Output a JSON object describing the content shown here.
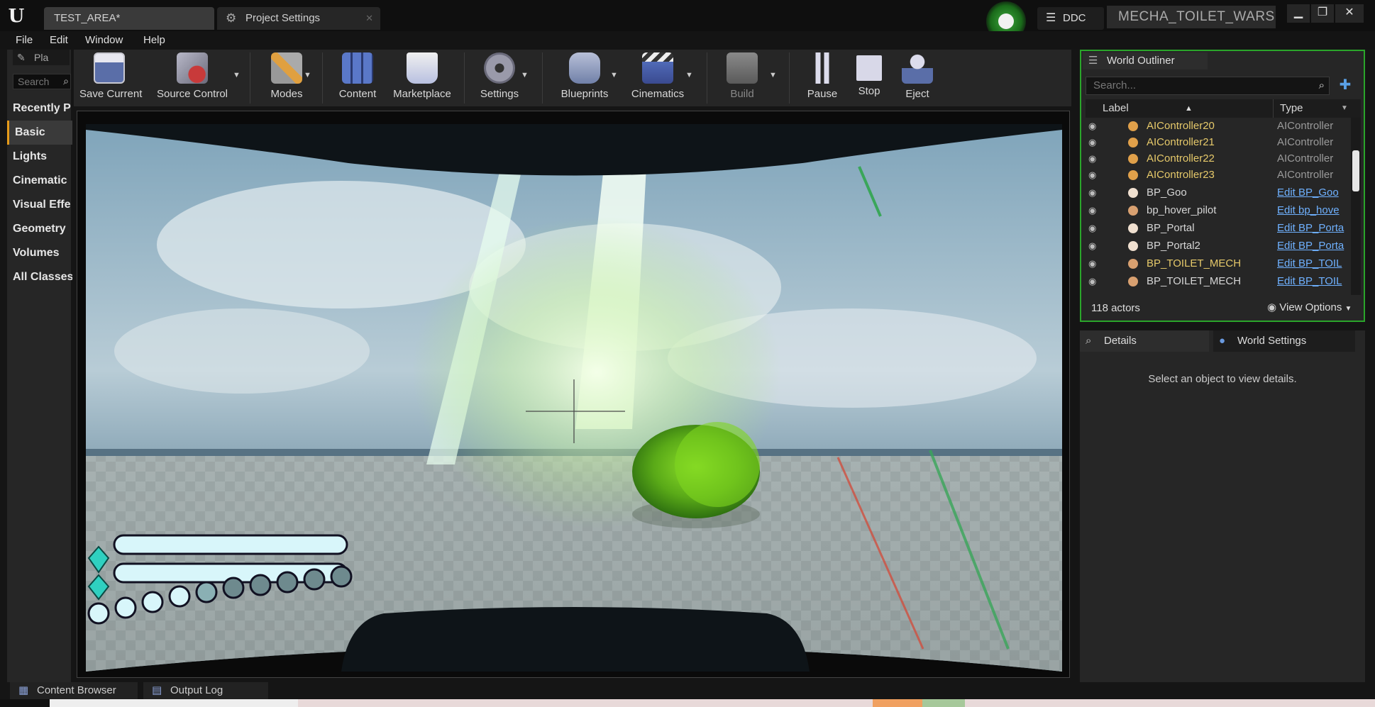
{
  "titlebar": {
    "tabs": [
      {
        "label": "TEST_AREA*"
      },
      {
        "label": "Project Settings"
      }
    ],
    "ddc_label": "DDC",
    "project_name": "MECHA_TOILET_WARS"
  },
  "menu": [
    "File",
    "Edit",
    "Window",
    "Help"
  ],
  "modes_panel": {
    "tab_label": "Pla",
    "search_placeholder": "Search",
    "categories": [
      "Recently P",
      "Basic",
      "Lights",
      "Cinematic",
      "Visual Effe",
      "Geometry",
      "Volumes",
      "All Classes"
    ],
    "active_category": "Basic"
  },
  "toolbar": {
    "buttons": [
      {
        "label": "Save Current",
        "icon": "save-icon"
      },
      {
        "label": "Source Control",
        "icon": "source-control-icon"
      },
      {
        "label": "Modes",
        "icon": "modes-icon"
      },
      {
        "label": "Content",
        "icon": "content-icon"
      },
      {
        "label": "Marketplace",
        "icon": "marketplace-icon"
      },
      {
        "label": "Settings",
        "icon": "settings-icon"
      },
      {
        "label": "Blueprints",
        "icon": "blueprints-icon"
      },
      {
        "label": "Cinematics",
        "icon": "cinematics-icon"
      },
      {
        "label": "Build",
        "icon": "build-icon"
      },
      {
        "label": "Pause",
        "icon": "pause-icon"
      },
      {
        "label": "Stop",
        "icon": "stop-icon"
      },
      {
        "label": "Eject",
        "icon": "eject-icon"
      }
    ]
  },
  "outliner": {
    "tab_label": "World Outliner",
    "search_placeholder": "Search...",
    "columns": {
      "label": "Label",
      "type": "Type"
    },
    "rows": [
      {
        "label": "AIController20",
        "type": "AIController",
        "link": false
      },
      {
        "label": "AIController21",
        "type": "AIController",
        "link": false
      },
      {
        "label": "AIController22",
        "type": "AIController",
        "link": false
      },
      {
        "label": "AIController23",
        "type": "AIController",
        "link": false
      },
      {
        "label": "BP_Goo",
        "type": "Edit BP_Goo",
        "link": true
      },
      {
        "label": "bp_hover_pilot",
        "type": "Edit bp_hove",
        "link": true
      },
      {
        "label": "BP_Portal",
        "type": "Edit BP_Porta",
        "link": true
      },
      {
        "label": "BP_Portal2",
        "type": "Edit BP_Porta",
        "link": true
      },
      {
        "label": "BP_TOILET_MECH",
        "type": "Edit BP_TOIL",
        "link": true
      },
      {
        "label": "BP_TOILET_MECH",
        "type": "Edit BP_TOIL",
        "link": true
      }
    ],
    "actor_count": "118 actors",
    "view_options": "View Options"
  },
  "details": {
    "tabs": [
      "Details",
      "World Settings"
    ],
    "empty_message": "Select an object to view details."
  },
  "bottom_tabs": [
    "Content Browser",
    "Output Log"
  ],
  "colors": {
    "accent_green": "#2aa52a",
    "link_blue": "#6fb1ff",
    "actor_yellow": "#e6c96a",
    "health_cyan": "#2fd0c0"
  }
}
